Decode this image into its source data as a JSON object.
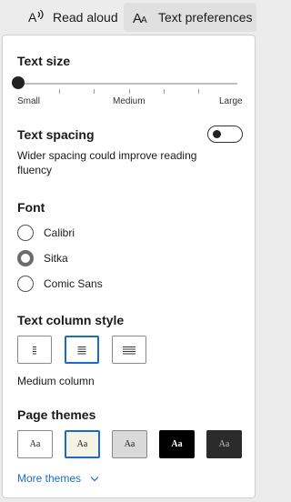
{
  "toolbar": {
    "read_aloud": "Read aloud",
    "text_preferences": "Text preferences"
  },
  "text_size": {
    "title": "Text size",
    "value_fraction": 0.0,
    "labels": {
      "small": "Small",
      "medium": "Medium",
      "large": "Large"
    }
  },
  "text_spacing": {
    "title": "Text spacing",
    "description_line1": "Wider spacing could improve reading",
    "description_line2": "fluency",
    "enabled": false
  },
  "font": {
    "title": "Font",
    "options": [
      {
        "label": "Calibri",
        "selected": false
      },
      {
        "label": "Sitka",
        "selected": true
      },
      {
        "label": "Comic Sans",
        "selected": false
      }
    ]
  },
  "column_style": {
    "title": "Text column style",
    "selected_label": "Medium column",
    "selected_index": 1
  },
  "page_themes": {
    "title": "Page themes",
    "themes": [
      {
        "text": "Aa",
        "bg": "#ffffff",
        "fg": "#1a1a1a",
        "border": "#8a8a8a"
      },
      {
        "text": "Aa",
        "bg": "#f7f3e4",
        "fg": "#1a1a1a",
        "border": "#1b6ac9"
      },
      {
        "text": "Aa",
        "bg": "#d9d9d9",
        "fg": "#1a1a1a",
        "border": "#8a8a8a"
      },
      {
        "text": "Aa",
        "bg": "#000000",
        "fg": "#ffffff",
        "border": "#000000"
      },
      {
        "text": "Aa",
        "bg": "#2b2b2b",
        "fg": "#bfbfbf",
        "border": "#2b2b2b"
      }
    ],
    "more_label": "More themes"
  },
  "colors": {
    "accent": "#1b6ac9"
  }
}
